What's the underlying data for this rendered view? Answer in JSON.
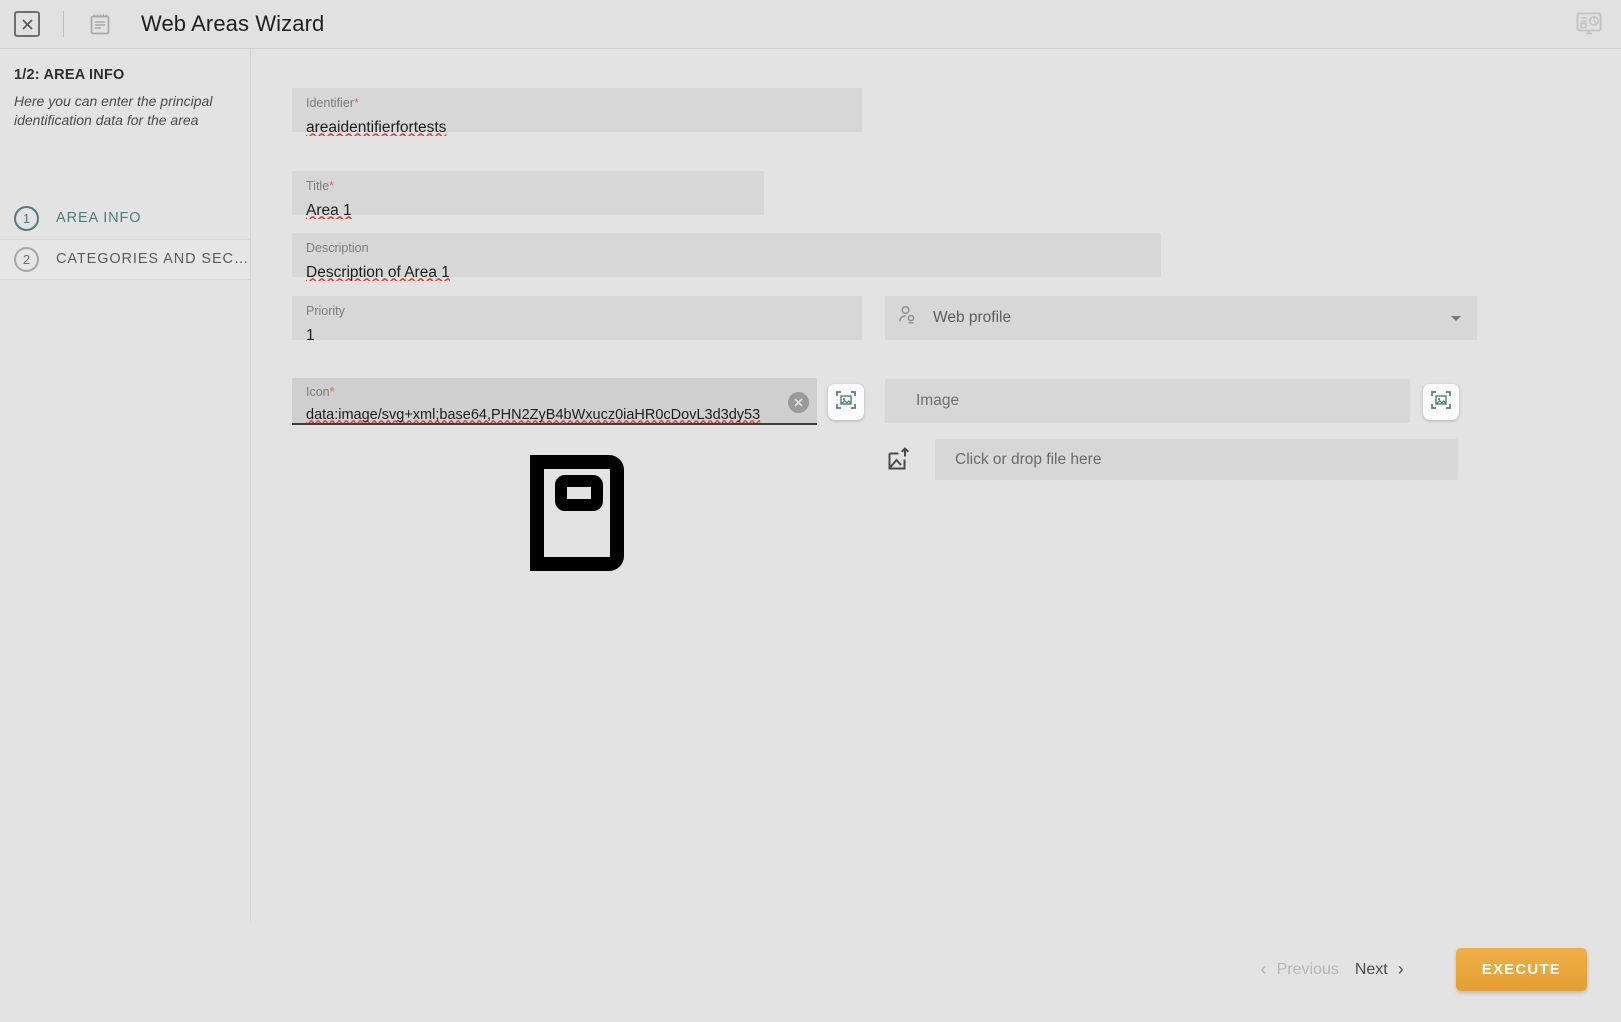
{
  "header": {
    "close_icon": "close-box-icon",
    "note_icon": "notepad-icon",
    "title": "Web Areas Wizard",
    "dashboard_icon": "monitor-chart-icon"
  },
  "sidebar": {
    "step_title": "1/2: AREA INFO",
    "step_description": "Here you can enter the principal identification data for the area",
    "steps": [
      {
        "number": "1",
        "label": "AREA INFO",
        "active": true
      },
      {
        "number": "2",
        "label": "CATEGORIES AND SEC…",
        "active": false
      }
    ]
  },
  "form": {
    "identifier": {
      "label": "Identifier",
      "required": "*",
      "value": "areaidentifierfortests"
    },
    "title": {
      "label": "Title",
      "required": "*",
      "value": "Area 1"
    },
    "description": {
      "label": "Description",
      "required": "",
      "value": "Description of Area 1"
    },
    "priority": {
      "label": "Priority",
      "required": "",
      "value": "1"
    },
    "web_profile": {
      "icon": "user-badge-icon",
      "placeholder": "Web profile",
      "caret": "chevron-down-icon"
    },
    "icon_field": {
      "label": "Icon",
      "required": "*",
      "value": "data:image/svg+xml;base64,PHN2ZyB4bWxucz0iaHR0cDovL3d3dy53",
      "clear_icon": "clear-circle-icon"
    },
    "image_field": {
      "placeholder": "Image"
    },
    "scan_button_1": {
      "icon": "image-scan-icon"
    },
    "scan_button_2": {
      "icon": "image-scan-icon"
    },
    "dropzone": {
      "icon": "image-upload-icon",
      "label": "Click or drop file here"
    },
    "preview": {
      "icon": "book-preview-icon"
    }
  },
  "footer": {
    "previous_label": "Previous",
    "previous_icon": "chevron-left-icon",
    "next_label": "Next",
    "next_icon": "chevron-right-icon",
    "execute_label": "EXECUTE"
  },
  "colors": {
    "accent_teal": "#4d7f7a",
    "execute_orange": "#e8a63c",
    "required_asterisk": "#d4744a",
    "page_background": "#e3e3e3",
    "field_background": "#d7d7d7"
  }
}
